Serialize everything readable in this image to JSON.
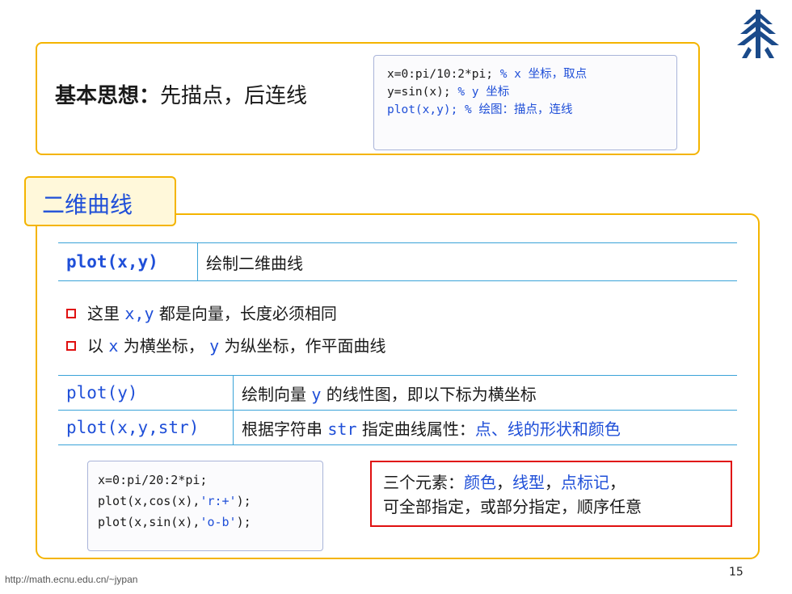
{
  "logo": {
    "icon": "ecnu-logo-icon",
    "color": "#1a4a8a"
  },
  "idea": {
    "title_bold": "基本思想：",
    "title_rest": "先描点，后连线",
    "code": [
      {
        "code": "x=0:pi/10:2*pi;",
        "comment": "% x 坐标，取点"
      },
      {
        "code": "y=sin(x);",
        "comment": "% y 坐标"
      },
      {
        "code": "plot(x,y);",
        "comment": "% 绘图：描点，连线"
      }
    ]
  },
  "section": {
    "title": "二维曲线"
  },
  "table1": {
    "cmd": "plot(x,y)",
    "desc": "绘制二维曲线"
  },
  "bullets": [
    {
      "pre": "这里 ",
      "code": "x,y",
      "post": " 都是向量，长度必须相同"
    },
    {
      "pre": "以 ",
      "code": "x",
      "mid": " 为横坐标，",
      "code2": "y",
      "post": " 为纵坐标，作平面曲线"
    }
  ],
  "table2": [
    {
      "cmd": "plot(y)",
      "desc_pre": "绘制向量 ",
      "desc_code": "y",
      "desc_post": " 的线性图，即以下标为横坐标"
    },
    {
      "cmd": "plot(x,y,str)",
      "desc_pre": "根据字符串 ",
      "desc_code": "str",
      "desc_post": " 指定曲线属性：",
      "desc_highlight": "点、线的形状和颜色"
    }
  ],
  "example": {
    "lines": [
      {
        "pre": "x=0:pi/20:2*pi;",
        "str": "",
        "post": ""
      },
      {
        "pre": "plot(x,cos(x),",
        "str": "'r:+'",
        "post": ");"
      },
      {
        "pre": "plot(x,sin(x),",
        "str": "'o-b'",
        "post": ");"
      }
    ]
  },
  "note": {
    "line1_pre": "三个元素：",
    "item1": "颜色",
    "sep1": "，",
    "item2": "线型",
    "sep2": "，",
    "item3": "点标记",
    "line1_post": "，",
    "line2": "可全部指定，或部分指定，顺序任意"
  },
  "footer": {
    "url": "http://math.ecnu.edu.cn/~jypan",
    "page": "15"
  },
  "colors": {
    "accent": "#f4b400",
    "blue": "#1f4fd8",
    "red": "#e01010",
    "rule": "#3aa3d8"
  }
}
